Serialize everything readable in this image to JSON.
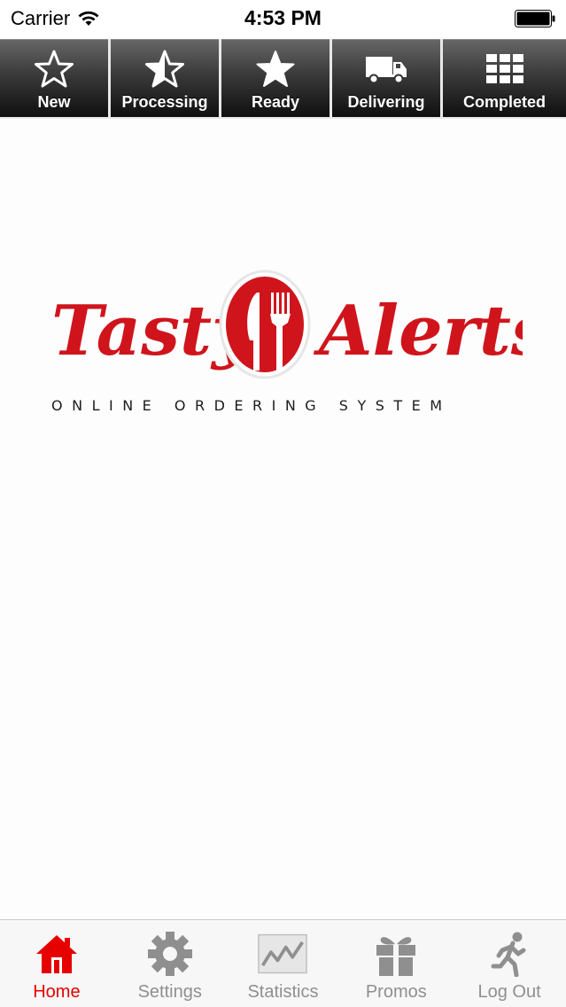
{
  "status_bar": {
    "carrier": "Carrier",
    "time": "4:53 PM"
  },
  "top_tabs": [
    {
      "label": "New",
      "icon": "star-outline-icon"
    },
    {
      "label": "Processing",
      "icon": "star-half-icon"
    },
    {
      "label": "Ready",
      "icon": "star-filled-icon"
    },
    {
      "label": "Delivering",
      "icon": "truck-icon"
    },
    {
      "label": "Completed",
      "icon": "grid-icon"
    }
  ],
  "logo": {
    "brand_left": "Tasty",
    "brand_right": "Alerts",
    "tagline": "ONLINE ORDERING SYSTEM"
  },
  "bottom_tabs": [
    {
      "label": "Home",
      "icon": "home-icon",
      "active": true
    },
    {
      "label": "Settings",
      "icon": "gear-icon",
      "active": false
    },
    {
      "label": "Statistics",
      "icon": "chart-icon",
      "active": false
    },
    {
      "label": "Promos",
      "icon": "gift-icon",
      "active": false
    },
    {
      "label": "Log Out",
      "icon": "running-man-icon",
      "active": false
    }
  ],
  "colors": {
    "brand_red": "#d0141c",
    "active_tab": "#e60000",
    "inactive_tab": "#8f8f8f"
  }
}
